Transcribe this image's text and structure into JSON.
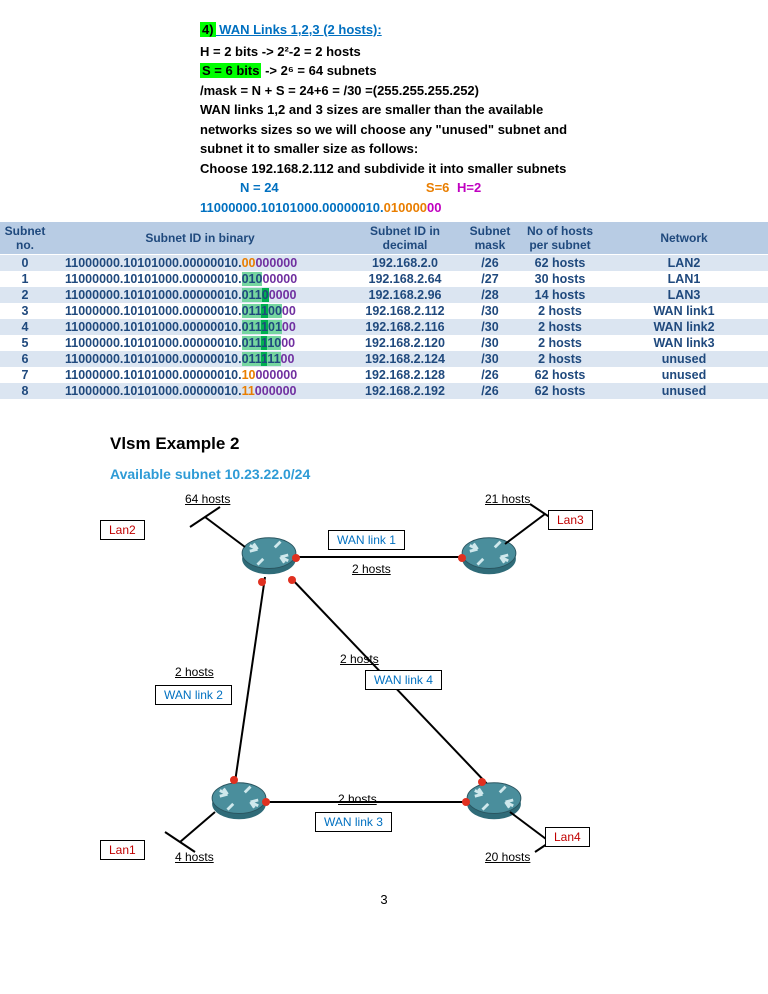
{
  "header": {
    "num": "4)",
    "title": " WAN Links 1,2,3 (2 hosts):",
    "line_h": "H = 2 bits -> 2²-2 = 2 hosts",
    "s6": "S = 6 bits",
    "line_s_rest": " -> 2⁶ = 64 subnets",
    "line_mask": "/mask = N + S = 24+6 = /30 =(255.255.255.252)",
    "line_exp1": "WAN links 1,2 and 3 sizes are smaller than the available",
    "line_exp2": "networks sizes so we will choose any \"unused\" subnet and",
    "line_exp3": "subnet it to smaller size as follows:",
    "line_choose": "Choose 192.168.2.112 and subdivide it into smaller subnets",
    "n24": "N = 24",
    "s6o": "S=6",
    "h2": "H=2",
    "bin_net": "11000000.10101000.00000010",
    "bin_dot": ".",
    "bin_sub": "010000",
    "bin_host": "00"
  },
  "table": {
    "headers": {
      "c0": "Subnet no.",
      "c1": "Subnet ID in binary",
      "c2": "Subnet ID in decimal",
      "c3": "Subnet mask",
      "c4": "No of hosts per subnet",
      "c5": "Network"
    },
    "rows": [
      {
        "no": "0",
        "fixed": "11000000.10101000.00000010.",
        "s": "00",
        "g": "",
        "rest": "",
        "host": "000000",
        "dec": "192.168.2.0",
        "mask": "/26",
        "hosts": "62 hosts",
        "net": "LAN2",
        "style": "a"
      },
      {
        "no": "1",
        "fixed": "11000000.10101000.00000010.",
        "s": "010",
        "g": "",
        "rest": "",
        "host": "00000",
        "dec": "192.168.2.64",
        "mask": "/27",
        "hosts": "30 hosts",
        "net": "LAN1",
        "style": "b"
      },
      {
        "no": "2",
        "fixed": "11000000.10101000.00000010.",
        "s": "011",
        "g": "0",
        "rest": "",
        "host": "0000",
        "dec": "192.168.2.96",
        "mask": "/28",
        "hosts": "14 hosts",
        "net": "LAN3",
        "style": "c"
      },
      {
        "no": "3",
        "fixed": "11000000.10101000.00000010.",
        "s": "011",
        "g": "1",
        "rest": "00",
        "host": "00",
        "dec": "192.168.2.112",
        "mask": "/30",
        "hosts": "2 hosts",
        "net": "WAN link1",
        "style": "c"
      },
      {
        "no": "4",
        "fixed": "11000000.10101000.00000010.",
        "s": "011",
        "g": "1",
        "rest": "01",
        "host": "00",
        "dec": "192.168.2.116",
        "mask": "/30",
        "hosts": "2 hosts",
        "net": "WAN link2",
        "style": "c"
      },
      {
        "no": "5",
        "fixed": "11000000.10101000.00000010.",
        "s": "011",
        "g": "1",
        "rest": "10",
        "host": "00",
        "dec": "192.168.2.120",
        "mask": "/30",
        "hosts": "2 hosts",
        "net": "WAN link3",
        "style": "c"
      },
      {
        "no": "6",
        "fixed": "11000000.10101000.00000010.",
        "s": "011",
        "g": "1",
        "rest": "11",
        "host": "00",
        "dec": "192.168.2.124",
        "mask": "/30",
        "hosts": "2 hosts",
        "net": "unused",
        "style": "c"
      },
      {
        "no": "7",
        "fixed": "11000000.10101000.00000010.",
        "s": "10",
        "g": "",
        "rest": "",
        "host": "000000",
        "dec": "192.168.2.128",
        "mask": "/26",
        "hosts": "62 hosts",
        "net": "unused",
        "style": "a"
      },
      {
        "no": "8",
        "fixed": "11000000.10101000.00000010.",
        "s": "11",
        "g": "",
        "rest": "",
        "host": "000000",
        "dec": "192.168.2.192",
        "mask": "/26",
        "hosts": "62 hosts",
        "net": "unused",
        "style": "a"
      }
    ]
  },
  "example2": {
    "title": "Vlsm Example 2",
    "available": "Available subnet 10.23.22.0/24"
  },
  "diagram": {
    "lan1": "Lan1",
    "lan2": "Lan2",
    "lan3": "Lan3",
    "lan4": "Lan4",
    "wan1": "WAN link 1",
    "wan2": "WAN link 2",
    "wan3": "WAN link 3",
    "wan4": "WAN link 4",
    "h64": "64 hosts",
    "h21": "21 hosts",
    "h4": "4 hosts",
    "h20": "20 hosts",
    "h2a": "2 hosts",
    "h2b": "2 hosts",
    "h2c": "2 hosts",
    "h2d": "2 hosts"
  },
  "pagenum": "3"
}
